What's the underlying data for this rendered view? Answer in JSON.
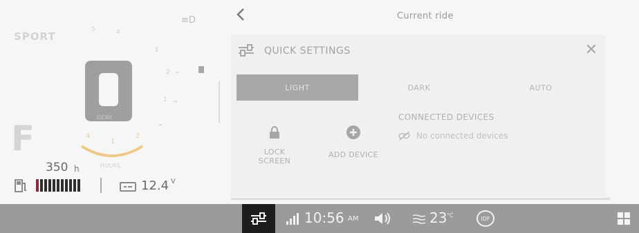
{
  "cluster": {
    "mode": "SPORT",
    "fuel_letter": "F",
    "gear_label": "GEAR",
    "hours": {
      "value": "350",
      "unit": "h"
    },
    "hours_label": "HOURS",
    "voltage": {
      "value": "12.4",
      "unit": "V"
    },
    "fuel_level_bars": 10,
    "rpm_ticks": [
      "5",
      "4",
      "3",
      "2",
      "1"
    ],
    "arc_labels": [
      "4",
      "1",
      "2"
    ],
    "colors": {
      "gear": "#9f9f9f",
      "arc": "#f0c98a",
      "fuel_bar": "#2e2e2e"
    }
  },
  "header": {
    "back_icon": "chevron-left-icon",
    "title": "Current ride"
  },
  "quick_settings": {
    "title": "QUICK SETTINGS",
    "close_icon": "close-icon",
    "themes": [
      {
        "label": "LIGHT",
        "selected": true
      },
      {
        "label": "DARK",
        "selected": false
      },
      {
        "label": "AUTO",
        "selected": false
      }
    ],
    "tiles": [
      {
        "icon": "lock-icon",
        "label_line1": "LOCK",
        "label_line2": "SCREEN"
      },
      {
        "icon": "add-circle-icon",
        "label_line1": "ADD DEVICE",
        "label_line2": ""
      }
    ],
    "connected_devices": {
      "title": "CONNECTED DEVICES",
      "empty_text": "No connected devices",
      "icon": "link-off-icon"
    }
  },
  "statusbar": {
    "time": "10:56",
    "ampm": "AM",
    "temperature": "23",
    "temperature_unit": "°C",
    "idf_badge": "IDF",
    "icons": [
      "quick-settings-icon",
      "signal-icon",
      "volume-icon",
      "temperature-icon",
      "apps-grid-icon"
    ],
    "colors": {
      "bar": "#9b9b9b",
      "active": "#1d1d1d"
    }
  }
}
